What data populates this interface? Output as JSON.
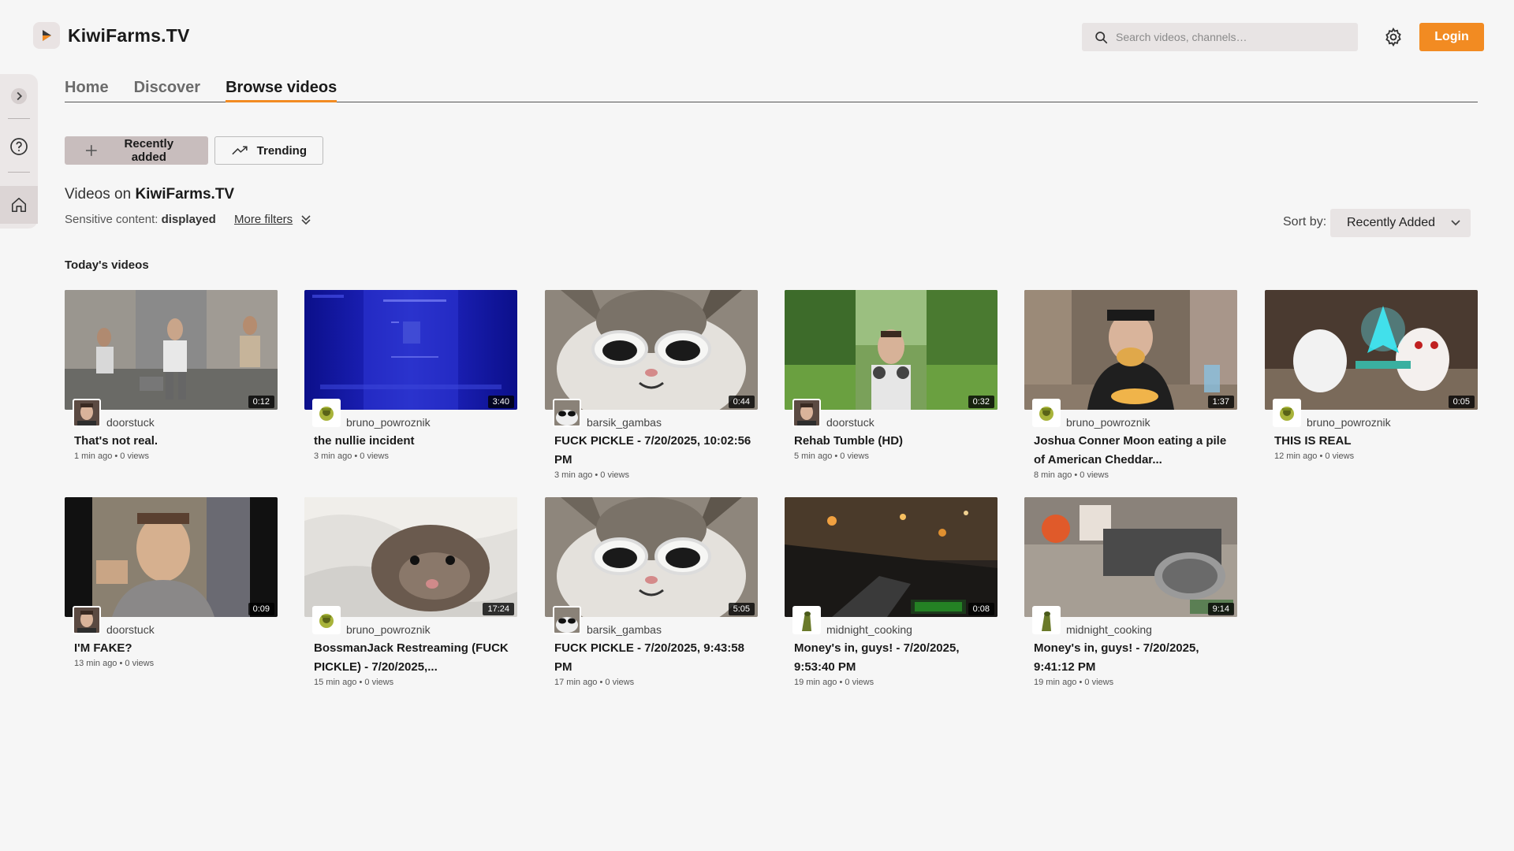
{
  "brand": {
    "name": "KiwiFarms.TV"
  },
  "search": {
    "placeholder": "Search videos, channels…"
  },
  "header": {
    "login_label": "Login"
  },
  "tabs": [
    {
      "label": "Home",
      "active": false
    },
    {
      "label": "Discover",
      "active": false
    },
    {
      "label": "Browse videos",
      "active": true
    }
  ],
  "filters": {
    "recently_added": "Recently added",
    "trending": "Trending"
  },
  "heading": {
    "prefix": "Videos on",
    "site": "KiwiFarms.TV"
  },
  "sensitive": {
    "label": "Sensitive content:",
    "value": "displayed"
  },
  "more_filters": "More filters",
  "sort": {
    "label": "Sort by:",
    "value": "Recently Added"
  },
  "section": {
    "title": "Today's videos"
  },
  "colors": {
    "accent": "#f28b22",
    "primary_button": "#c8bdbd"
  },
  "videos": [
    {
      "title": "That's not real.",
      "channel": "doorstuck",
      "meta": "1 min ago • 0 views",
      "duration": "0:12",
      "avatar": "doorstuck"
    },
    {
      "title": "the nullie incident",
      "channel": "bruno_powroznik",
      "meta": "3 min ago • 0 views",
      "duration": "3:40",
      "avatar": "bruno"
    },
    {
      "title": "FUCK PICKLE - 7/20/2025, 10:02:56 PM",
      "channel": "barsik_gambas",
      "meta": "3 min ago • 0 views",
      "duration": "0:44",
      "avatar": "barsik"
    },
    {
      "title": "Rehab Tumble (HD)",
      "channel": "doorstuck",
      "meta": "5 min ago • 0 views",
      "duration": "0:32",
      "avatar": "doorstuck"
    },
    {
      "title": "Joshua Conner Moon eating a pile of American Cheddar...",
      "channel": "bruno_powroznik",
      "meta": "8 min ago • 0 views",
      "duration": "1:37",
      "avatar": "bruno"
    },
    {
      "title": "THIS IS REAL",
      "channel": "bruno_powroznik",
      "meta": "12 min ago • 0 views",
      "duration": "0:05",
      "avatar": "bruno"
    },
    {
      "title": "I'M FAKE?",
      "channel": "doorstuck",
      "meta": "13 min ago • 0 views",
      "duration": "0:09",
      "avatar": "doorstuck"
    },
    {
      "title": "BossmanJack Restreaming (FUCK PICKLE) - 7/20/2025,...",
      "channel": "bruno_powroznik",
      "meta": "15 min ago • 0 views",
      "duration": "17:24",
      "avatar": "bruno"
    },
    {
      "title": "FUCK PICKLE - 7/20/2025, 9:43:58 PM",
      "channel": "barsik_gambas",
      "meta": "17 min ago • 0 views",
      "duration": "5:05",
      "avatar": "barsik"
    },
    {
      "title": "Money's in, guys! - 7/20/2025, 9:53:40 PM",
      "channel": "midnight_cooking",
      "meta": "19 min ago • 0 views",
      "duration": "0:08",
      "avatar": "midnight"
    },
    {
      "title": "Money's in, guys! - 7/20/2025, 9:41:12 PM",
      "channel": "midnight_cooking",
      "meta": "19 min ago • 0 views",
      "duration": "9:14",
      "avatar": "midnight"
    }
  ]
}
